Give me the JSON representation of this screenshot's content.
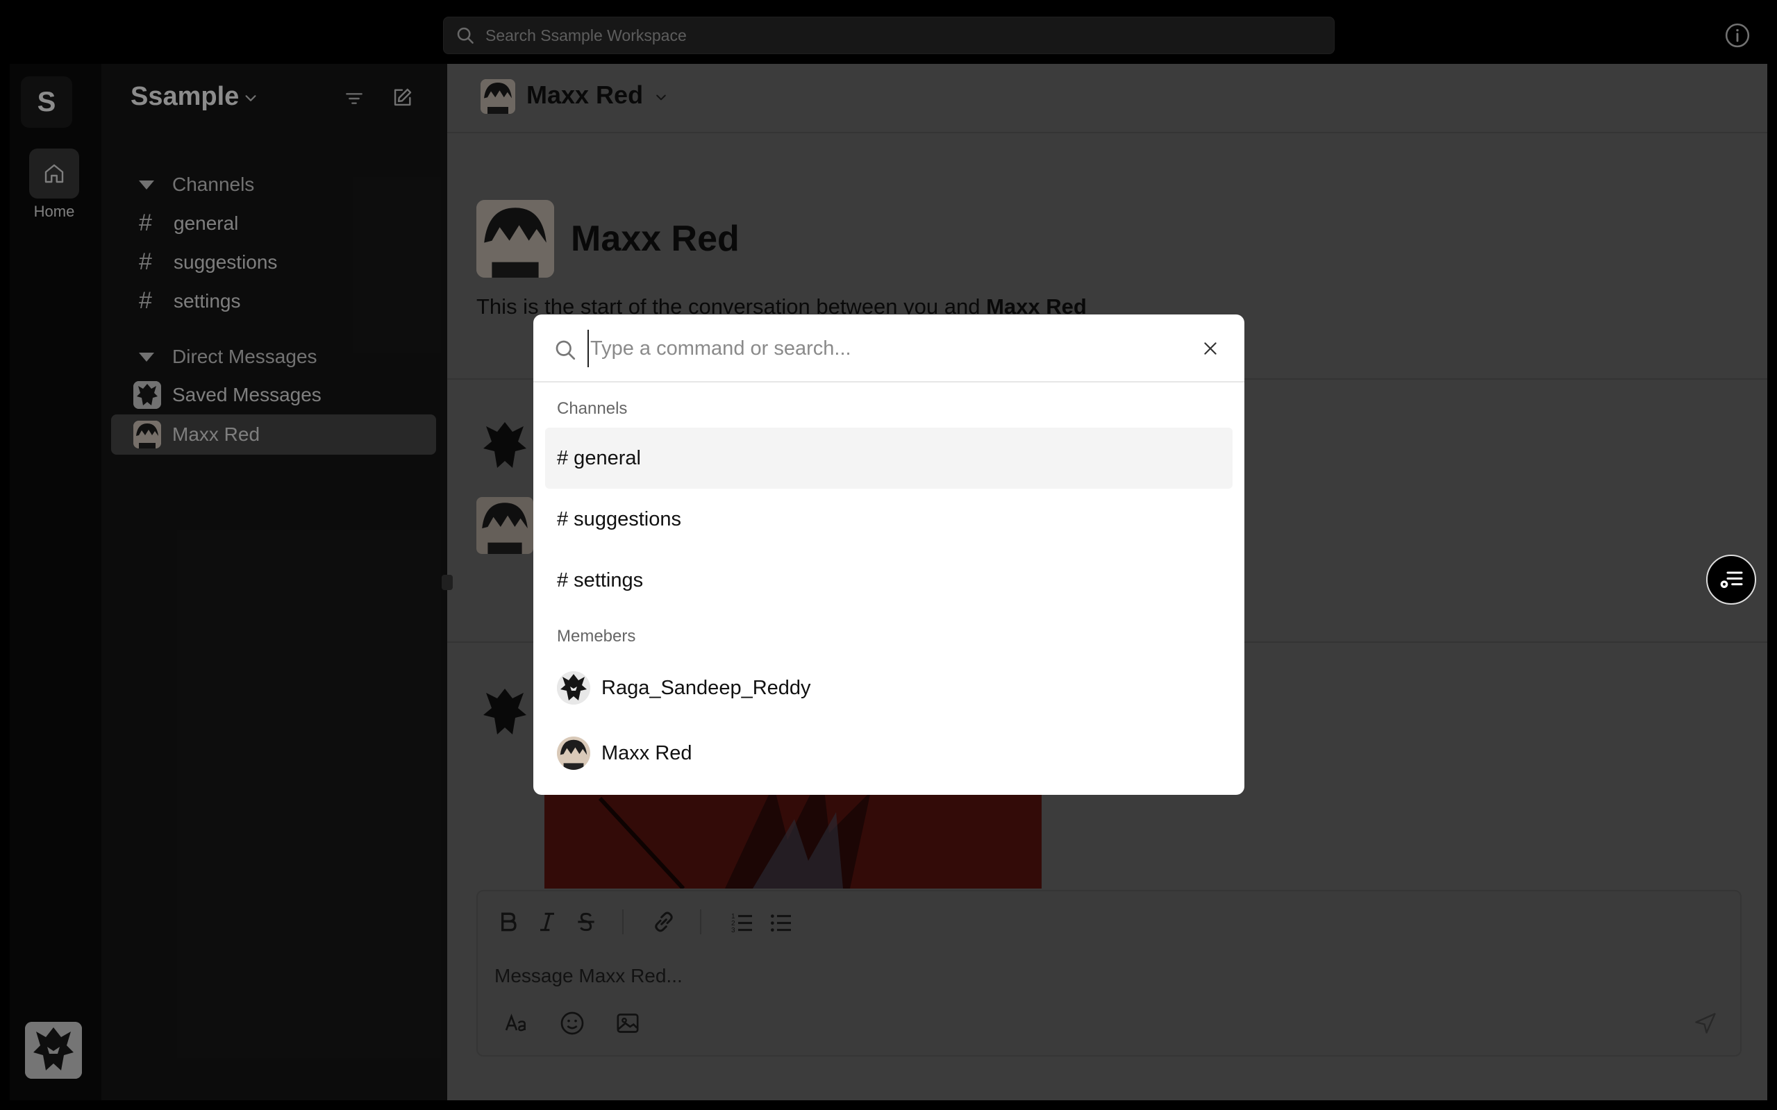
{
  "topbar": {
    "search_placeholder": "Search Ssample Workspace"
  },
  "rail": {
    "workspace_initial": "S",
    "home_label": "Home"
  },
  "sidebar": {
    "workspace_name": "Ssample",
    "channels_header": "Channels",
    "channels": [
      "general",
      "suggestions",
      "settings"
    ],
    "dm_header": "Direct Messages",
    "dms": [
      {
        "name": "Saved Messages",
        "active": false
      },
      {
        "name": "Maxx Red",
        "active": true
      }
    ]
  },
  "main": {
    "header_name": "Maxx Red",
    "profile_name": "Maxx Red",
    "start_text_prefix": "This is the start of the conversation between you and ",
    "start_text_name": "Maxx Red",
    "composer_placeholder": "Message Maxx Red..."
  },
  "palette": {
    "placeholder": "Type a command or search...",
    "channels_label": "Channels",
    "channels": [
      "# general",
      "# suggestions",
      "# settings"
    ],
    "selected_index": 0,
    "members_label": "Memebers",
    "members": [
      "Raga_Sandeep_Reddy",
      "Maxx Red"
    ]
  },
  "colors": {
    "main_bg": "#6e6e6e",
    "sidebar_bg": "#171717",
    "active_item": "#4a4a4a",
    "palette_bg": "#ffffff",
    "palette_selected": "#f4f4f4"
  }
}
